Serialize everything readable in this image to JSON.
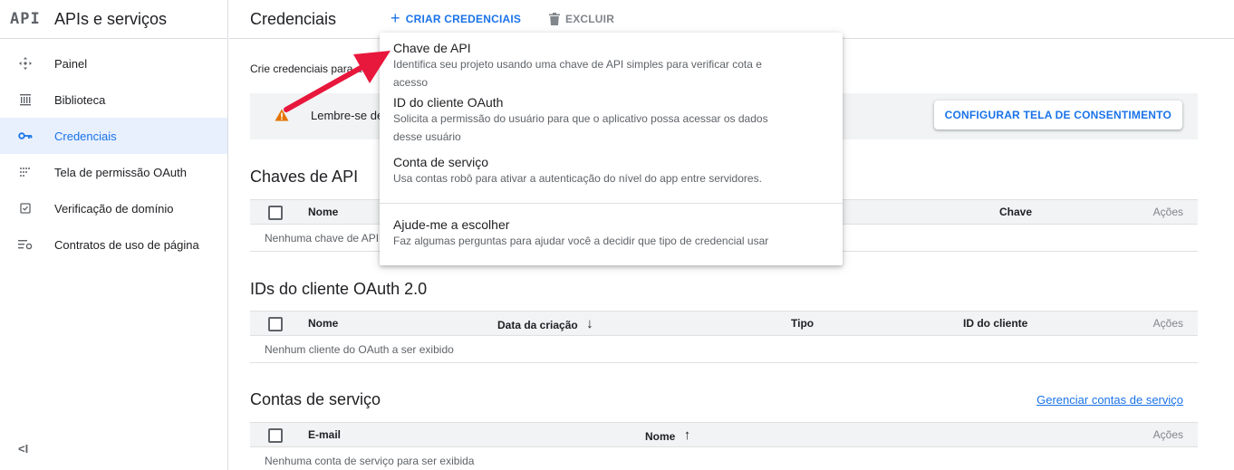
{
  "sidebar": {
    "logo": "API",
    "title": "APIs e serviços",
    "items": [
      {
        "label": "Painel",
        "icon": "dashboard-icon"
      },
      {
        "label": "Biblioteca",
        "icon": "library-icon"
      },
      {
        "label": "Credenciais",
        "icon": "key-icon",
        "active": true
      },
      {
        "label": "Tela de permissão OAuth",
        "icon": "oauth-consent-icon"
      },
      {
        "label": "Verificação de domínio",
        "icon": "domain-check-icon"
      },
      {
        "label": "Contratos de uso de página",
        "icon": "page-agreements-icon"
      }
    ],
    "collapse": "<I"
  },
  "header": {
    "title": "Credenciais",
    "create_label": "CRIAR CREDENCIAIS",
    "create_icon": "+",
    "delete_label": "EXCLUIR"
  },
  "main": {
    "intro": "Crie credenciais para ace",
    "banner_text": "Lembre-se de",
    "consent_button": "CONFIGURAR TELA DE CONSENTIMENTO"
  },
  "api_keys": {
    "title": "Chaves de API",
    "columns": {
      "name": "Nome",
      "key": "Chave",
      "actions": "Ações"
    },
    "empty": "Nenhuma chave de API"
  },
  "oauth": {
    "title": "IDs do cliente OAuth 2.0",
    "columns": {
      "name": "Nome",
      "created": "Data da criação",
      "type": "Tipo",
      "client_id": "ID do cliente",
      "actions": "Ações"
    },
    "sort_indicator": "↓",
    "empty": "Nenhum cliente do OAuth a ser exibido"
  },
  "service_accounts": {
    "title": "Contas de serviço",
    "manage_link": "Gerenciar contas de serviço",
    "columns": {
      "email": "E-mail",
      "name": "Nome",
      "actions": "Ações"
    },
    "sort_indicator": "↑",
    "empty": "Nenhuma conta de serviço para ser exibida"
  },
  "menu": {
    "items": [
      {
        "title": "Chave de API",
        "desc_1": "Identifica seu projeto usando uma chave de API simples para verificar cota e",
        "desc_2": "acesso"
      },
      {
        "title": "ID do cliente OAuth",
        "desc_1": "Solicita a permissão do usuário para que o aplicativo possa acessar os dados",
        "desc_2": "desse usuário"
      },
      {
        "title": "Conta de serviço",
        "desc_1": "Usa contas robô para ativar a autenticação do nível do app entre servidores."
      },
      {
        "title": "Ajude-me a escolher",
        "desc_1": "Faz algumas perguntas para ajudar você a decidir que tipo de credencial usar"
      }
    ]
  },
  "colors": {
    "accent": "#1a73e8",
    "active_bg": "#e8f0fe",
    "warning": "#e37400",
    "annotation_arrow": "#e8173c"
  }
}
